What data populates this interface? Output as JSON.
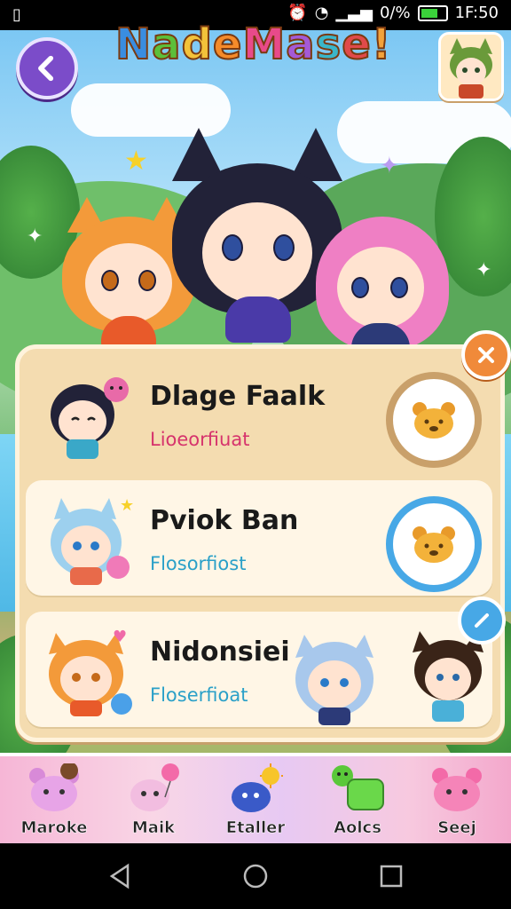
{
  "status_bar": {
    "battery_percent": "0/%",
    "time": "1F:50"
  },
  "header": {
    "title": "NadeMase!",
    "title_colors": [
      "#3a8de0",
      "#5cbf3a",
      "#f3c23a",
      "#f58b2a",
      "#e84a8a",
      "#a45ad6",
      "#3ab6c9",
      "#e04a4a",
      "#f3a23a"
    ],
    "back_icon": "chevron-left-icon",
    "avatar_icon": "profile-avatar-icon"
  },
  "panel": {
    "close_icon": "close-icon",
    "edit_icon": "pencil-icon",
    "cards": [
      {
        "name": "Dlage Faalk",
        "subtitle": "Lioeorfiuat",
        "subtitle_color": "#d6336c",
        "action_icon": "bear-icon",
        "ring_color": "#c9a06a"
      },
      {
        "name": "Pviok Ban",
        "subtitle": "Flosorfiost",
        "subtitle_color": "#2aa0c8",
        "action_icon": "bear-icon",
        "ring_color": "#47a8e6"
      },
      {
        "name": "Nidonsiei",
        "subtitle": "Floserfioat",
        "subtitle_color": "#2aa0c8"
      }
    ]
  },
  "bottom_nav": {
    "items": [
      {
        "label": "Maroke",
        "icon": "pink-bear-icon"
      },
      {
        "label": "Maik",
        "icon": "balloon-bunny-icon"
      },
      {
        "label": "Etaller",
        "icon": "sun-monster-icon"
      },
      {
        "label": "Aolcs",
        "icon": "green-phone-icon"
      },
      {
        "label": "Seej",
        "icon": "pink-bear-icon"
      }
    ]
  },
  "system_nav": {
    "back_icon": "triangle-back-icon",
    "home_icon": "circle-home-icon",
    "recents_icon": "square-recents-icon"
  }
}
